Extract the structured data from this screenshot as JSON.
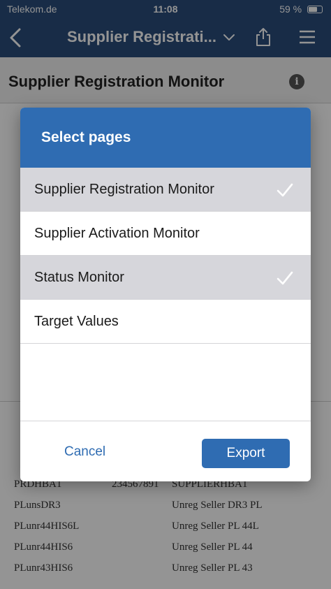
{
  "status_bar": {
    "carrier": "Telekom.de",
    "time": "11:08",
    "battery": "59 %"
  },
  "nav_bar": {
    "title": "Supplier Registrati..."
  },
  "page": {
    "title": "Supplier Registration Monitor"
  },
  "background": {
    "table_rows": [
      {
        "id": "PRDHBA1",
        "number": "234567891",
        "name": "SUPPLIERHBA1"
      },
      {
        "id": "PLunsDR3",
        "number": "",
        "name": "Unreg Seller DR3 PL"
      },
      {
        "id": "PLunr44HIS6L",
        "number": "",
        "name": "Unreg Seller PL 44L"
      },
      {
        "id": "PLunr44HIS6",
        "number": "",
        "name": "Unreg Seller PL 44"
      },
      {
        "id": "PLunr43HIS6",
        "number": "",
        "name": "Unreg Seller PL 43"
      }
    ]
  },
  "dialog": {
    "title": "Select pages",
    "options": [
      {
        "label": "Supplier Registration Monitor",
        "selected": true
      },
      {
        "label": "Supplier Activation Monitor",
        "selected": false
      },
      {
        "label": "Status Monitor",
        "selected": true
      },
      {
        "label": "Target Values",
        "selected": false
      }
    ],
    "cancel_label": "Cancel",
    "export_label": "Export"
  },
  "colors": {
    "nav_bar": "#2a4d7a",
    "dialog_header": "#2f6cb2",
    "selected_row": "#d6d6db",
    "accent": "#2f6cb2"
  }
}
